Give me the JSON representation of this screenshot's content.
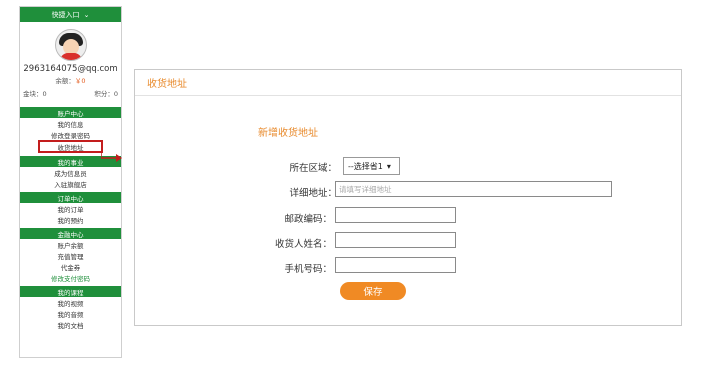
{
  "sidebar": {
    "quick_entry": "快捷入口",
    "email": "2963164075@qq.com",
    "balance_label": "余额：",
    "balance_value": "￥0",
    "gold_label": "金块：0",
    "points_label": "积分：0",
    "sections": [
      {
        "title": "账户中心",
        "items": [
          "我的信息",
          "修改登录密码",
          "收货地址"
        ]
      },
      {
        "title": "我的事业",
        "items": [
          "成为信息员",
          "入驻旗舰店"
        ]
      },
      {
        "title": "订单中心",
        "items": [
          "我的订单",
          "我的预约"
        ]
      },
      {
        "title": "金融中心",
        "items": [
          "账户余额",
          "充值管理",
          "代金券",
          "修改支付密码"
        ]
      },
      {
        "title": "我的课程",
        "items": [
          "我的视频",
          "我的音频",
          "我的文档"
        ]
      }
    ]
  },
  "panel": {
    "title": "收货地址",
    "form_title": "新增收货地址",
    "region_label": "所在区域：",
    "region_select": "--选择省1",
    "address_label": "详细地址：",
    "address_placeholder": "请填写详细地址",
    "zip_label": "邮政编码：",
    "name_label": "收货人姓名：",
    "phone_label": "手机号码：",
    "save_label": "保存"
  },
  "colors": {
    "green": "#1f8f3b",
    "orange": "#e88a2c",
    "button": "#f08a24",
    "highlight": "#c31d1d"
  },
  "icons": [
    "chevron-down-icon",
    "avatar-icon",
    "arrow-right-icon"
  ]
}
